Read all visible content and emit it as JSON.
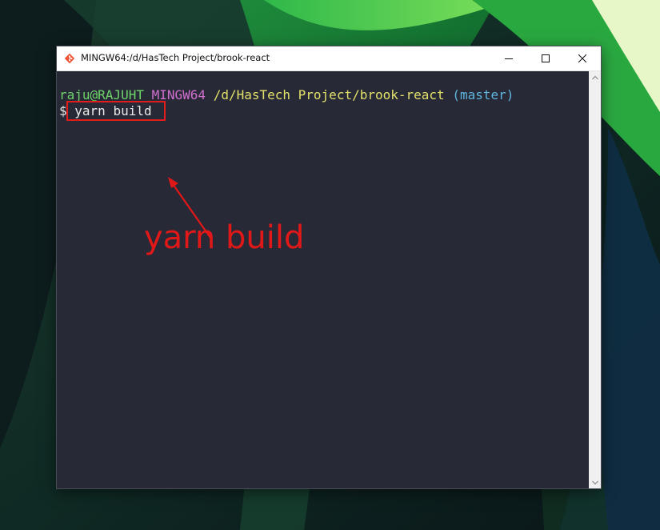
{
  "window": {
    "title": "MINGW64:/d/HasTech Project/brook-react",
    "app_icon": "git-bash-icon",
    "controls": {
      "minimize": "minimize-icon",
      "maximize": "maximize-icon",
      "close": "close-icon"
    }
  },
  "terminal": {
    "prompt": {
      "user_host": "raju@RAJUHT",
      "system": "MINGW64",
      "path": "/d/HasTech Project/brook-react",
      "branch": "(master)"
    },
    "command_line": {
      "symbol": "$",
      "command": "yarn build"
    }
  },
  "annotation": {
    "label": "yarn build",
    "color": "#e01818"
  },
  "colors": {
    "terminal_bg": "#272936",
    "user_host": "#6fd36a",
    "system": "#d16fcf",
    "path": "#e3e06a",
    "branch": "#5fb6e0"
  }
}
